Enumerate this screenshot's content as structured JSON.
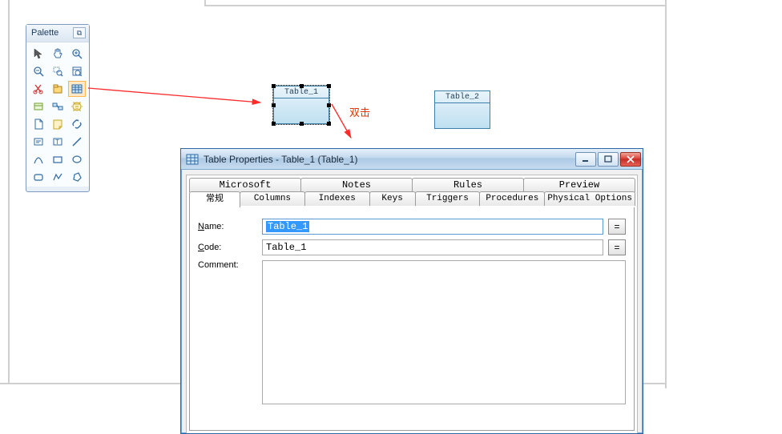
{
  "palette": {
    "title": "Palette",
    "close_label": "⧉"
  },
  "canvas": {
    "table1_label": "Table_1",
    "table2_label": "Table_2"
  },
  "annotation": {
    "double_click": "双击"
  },
  "window": {
    "title": "Table Properties - Table_1 (Table_1)",
    "tabs_top": {
      "microsoft": "Microsoft",
      "notes": "Notes",
      "rules": "Rules",
      "preview": "Preview"
    },
    "tabs_bottom": {
      "general": "常规",
      "columns": "Columns",
      "indexes": "Indexes",
      "keys": "Keys",
      "triggers": "Triggers",
      "procedures": "Procedures",
      "physical": "Physical Options"
    },
    "form": {
      "name_label": "Name:",
      "name_value": "Table_1",
      "code_label": "Code:",
      "code_value": "Table_1",
      "comment_label": "Comment:",
      "equals": "="
    }
  }
}
